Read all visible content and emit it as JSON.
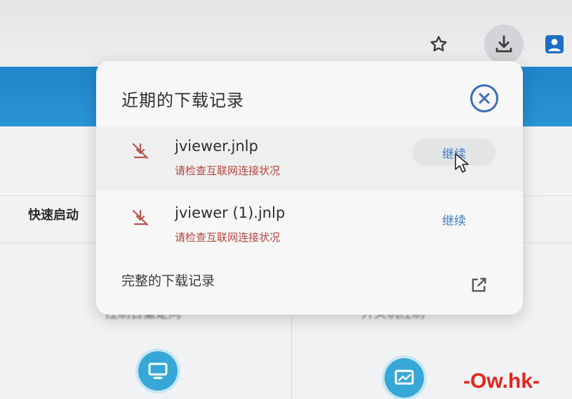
{
  "toolbar": {
    "star_icon": "star-outline-icon",
    "download_icon": "download-icon",
    "profile_icon": "person-icon"
  },
  "page": {
    "quick_start": "快速启动",
    "label_left": "控制台重定向",
    "label_right": "开关机控制"
  },
  "downloads_popup": {
    "title": "近期的下载记录",
    "items": [
      {
        "file_name": "jviewer.jnlp",
        "status": "请检查互联网连接状况",
        "action": "继续"
      },
      {
        "file_name": "jviewer (1).jnlp",
        "status": "请检查互联网连接状况",
        "action": "继续"
      }
    ],
    "full_history": "完整的下载记录"
  },
  "watermark": "-Ow.hk-",
  "colors": {
    "accent": "#3d7cc4",
    "error": "#b5453c",
    "header_band": "#1e86c9",
    "watermark": "#e8241c"
  }
}
